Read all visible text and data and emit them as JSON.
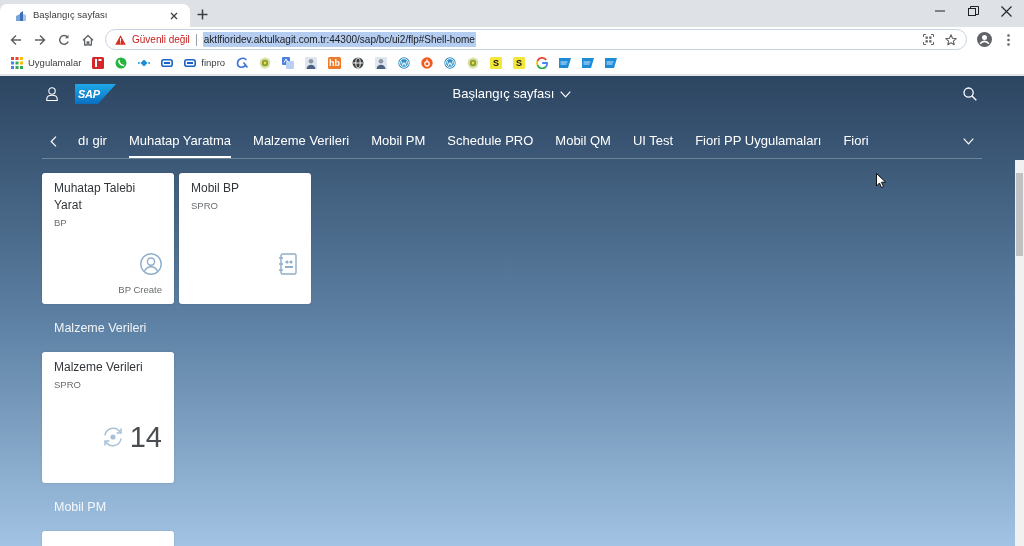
{
  "browser": {
    "tab": {
      "title": "Başlangıç sayfası"
    },
    "address_bar": {
      "security": "Güvenli değil",
      "url": "aktlfioridev.aktulkagit.com.tr:44300/sap/bc/ui2/flp#Shell-home",
      "selected": true
    },
    "bookmarks": [
      {
        "kind": "apps",
        "label": "Uygulamalar"
      },
      {
        "kind": "redtile"
      },
      {
        "kind": "chat"
      },
      {
        "kind": "diamond"
      },
      {
        "kind": "link"
      },
      {
        "kind": "link",
        "label": "finpro"
      },
      {
        "kind": "curve"
      },
      {
        "kind": "seal"
      },
      {
        "kind": "translate"
      },
      {
        "kind": "person"
      },
      {
        "kind": "letter",
        "label": "hb",
        "color": "#ee7a2c"
      },
      {
        "kind": "globe"
      },
      {
        "kind": "person"
      },
      {
        "kind": "wp"
      },
      {
        "kind": "orange"
      },
      {
        "kind": "wp"
      },
      {
        "kind": "seal"
      },
      {
        "kind": "letter",
        "label": "S",
        "color": "#f3e63a"
      },
      {
        "kind": "letter",
        "label": "S",
        "color": "#f3e63a"
      },
      {
        "kind": "google"
      },
      {
        "kind": "sap"
      },
      {
        "kind": "sap"
      },
      {
        "kind": "sap"
      }
    ]
  },
  "shell": {
    "logo": "SAP",
    "title": "Başlangıç sayfası"
  },
  "tabs": [
    {
      "label": "dı gir",
      "selected": false
    },
    {
      "label": "Muhatap Yaratma",
      "selected": true
    },
    {
      "label": "Malzeme Verileri",
      "selected": false
    },
    {
      "label": "Mobil PM",
      "selected": false
    },
    {
      "label": "Schedule PRO",
      "selected": false
    },
    {
      "label": "Mobil QM",
      "selected": false
    },
    {
      "label": "UI Test",
      "selected": false
    },
    {
      "label": "Fiori PP Uygulamaları",
      "selected": false
    },
    {
      "label": "Fiori",
      "selected": false
    }
  ],
  "groups": [
    {
      "tiles": [
        {
          "kind": "launch",
          "title": "Muhatap Talebi Yarat",
          "subtitle": "BP",
          "footer": "BP Create"
        },
        {
          "kind": "directory",
          "title": "Mobil BP",
          "subtitle": "SPRO"
        }
      ]
    },
    {
      "heading": "Malzeme Verileri",
      "tiles": [
        {
          "kind": "kpi",
          "title": "Malzeme Verileri",
          "subtitle": "SPRO",
          "number": "14"
        }
      ]
    },
    {
      "heading": "Mobil PM",
      "tiles": [
        {
          "kind": "partial"
        }
      ]
    }
  ]
}
